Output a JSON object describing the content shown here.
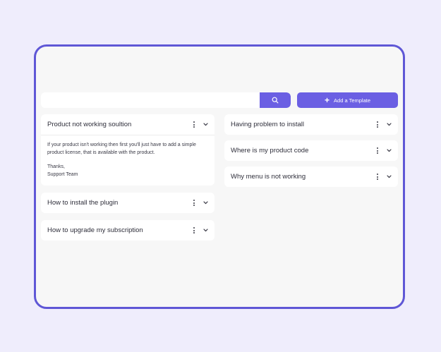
{
  "toolbar": {
    "search_placeholder": "",
    "search_value": "",
    "search_icon": "search-icon",
    "add_label": "Add a Template",
    "add_icon": "plus-icon"
  },
  "colors": {
    "accent": "#6b5fe3",
    "frame_border": "#5f57d6",
    "page_bg": "#efedfc",
    "panel_bg": "#f7f7f7"
  },
  "left_cards": [
    {
      "title": "Product not working soultion",
      "expanded": true,
      "body": {
        "text": "If your product isn't working then first you'll just have to add a simple product license, that is available with the product.",
        "closing": "Thanks,",
        "signature": "Support Team"
      }
    },
    {
      "title": "How to install the plugin",
      "expanded": false
    },
    {
      "title": "How to upgrade my subscription",
      "expanded": false
    }
  ],
  "right_cards": [
    {
      "title": "Having problem to install",
      "expanded": false
    },
    {
      "title": "Where is my product code",
      "expanded": false
    },
    {
      "title": "Why menu is not working",
      "expanded": false
    }
  ]
}
